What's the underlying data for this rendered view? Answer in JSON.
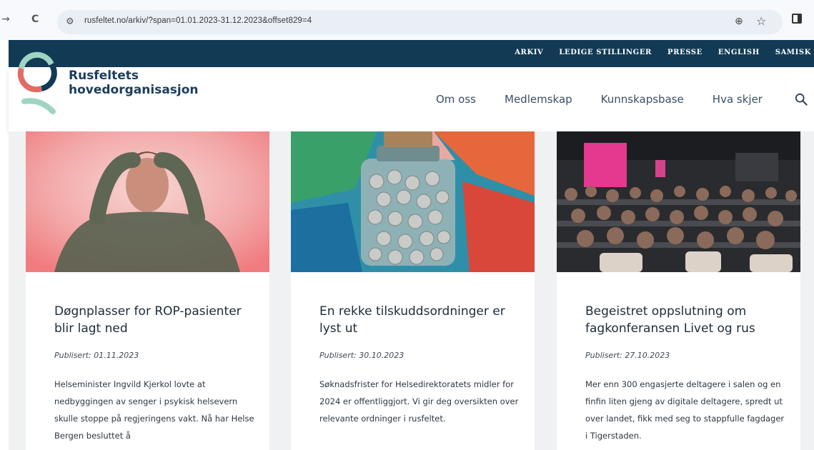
{
  "browser": {
    "back_glyph": "→",
    "reload_glyph": "C",
    "url": "rusfeltet.no/arkiv/?span=01.01.2023-31.12.2023&offset829=4",
    "site_info_glyph": "⚙",
    "zoom_glyph": "⊕",
    "bookmark_glyph": "☆"
  },
  "top_nav": {
    "items": [
      "ARKIV",
      "LEDIGE STILLINGER",
      "PRESSE",
      "ENGLISH",
      "SAMISK"
    ]
  },
  "site": {
    "name_line1": "Rusfeltets",
    "name_line2": "hovedorganisasjon"
  },
  "main_nav": {
    "items": [
      "Om oss",
      "Medlemskap",
      "Kunnskapsbase",
      "Hva skjer"
    ]
  },
  "colors": {
    "brand_navy": "#123a55",
    "logo_teal": "#9fd4c4",
    "logo_red": "#e26b63",
    "text_dark": "#1d2b38"
  },
  "icons": {
    "search": "search-icon",
    "bookmark": "star-icon",
    "zoom": "zoom-icon",
    "side_panel": "side-panel-icon"
  },
  "articles": [
    {
      "title": "Døgnplasser for ROP-pasienter blir lagt ned",
      "date": "Publisert: 01.11.2023",
      "excerpt": "Helseminister Ingvild Kjerkol lovte at nedbyggingen av senger i psykisk helsevern skulle stoppe på regjeringens vakt. Nå har Helse Bergen besluttet å"
    },
    {
      "title": "En rekke tilskuddsordninger er lyst ut",
      "date": "Publisert: 30.10.2023",
      "excerpt": "Søknadsfrister for Helsedirektoratets midler for 2024 er offentliggjort. Vi gir deg oversikten over relevante ordninger i rusfeltet."
    },
    {
      "title": "Begeistret oppslutning om fagkonferansen Livet og rus",
      "date": "Publisert: 27.10.2023",
      "excerpt": "Mer enn 300 engasjerte deltagere i salen og en finfin liten gjeng av digitale deltagere, spredt ut over landet, fikk med seg to stappfulle fagdager i Tigerstaden."
    }
  ]
}
